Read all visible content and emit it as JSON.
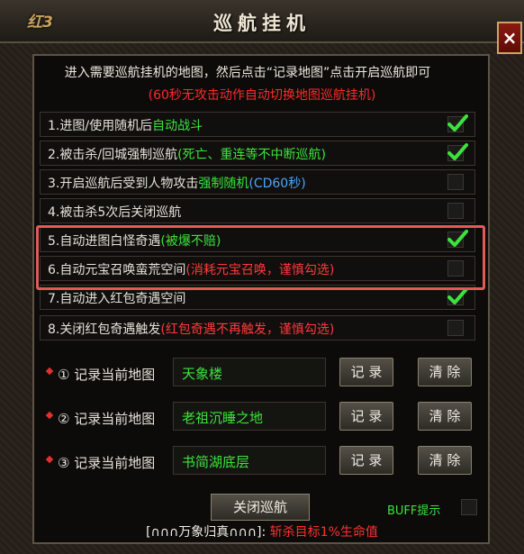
{
  "window": {
    "title": "巡航挂机",
    "logo_text": "红3",
    "close_label": "×"
  },
  "intro": {
    "line1": "进入需要巡航挂机的地图，然后点击“记录地图”点击开启巡航即可",
    "line2": "(60秒无攻击动作自动切换地图巡航挂机)"
  },
  "options": [
    {
      "main": "1.进图/使用随机后",
      "sub": "自动战斗",
      "sub_color": "green",
      "extra": "",
      "checked": true
    },
    {
      "main": "2.被击杀/回城强制巡航",
      "sub": "(死亡、重连等不中断巡航)",
      "sub_color": "green",
      "extra": "",
      "checked": true
    },
    {
      "main": "3.开启巡航后受到人物攻击",
      "sub": "强制随机",
      "sub_color": "green",
      "extra": "(CD60秒)",
      "checked": false
    },
    {
      "main": "4.被击杀5次后关闭巡航",
      "sub": "",
      "sub_color": "",
      "extra": "",
      "checked": false
    },
    {
      "main": "5.自动进图白怪奇遇",
      "sub": "(被爆不赔)",
      "sub_color": "green",
      "extra": "",
      "checked": true
    },
    {
      "main": "6.自动元宝召唤蛮荒空间",
      "sub": "(消耗元宝召唤，谨慎勾选)",
      "sub_color": "red",
      "extra": "",
      "checked": false
    },
    {
      "main": "7.自动进入红包奇遇空间",
      "sub": "",
      "sub_color": "",
      "extra": "",
      "checked": true
    },
    {
      "main": "8.关闭红包奇遇触发",
      "sub": "(红包奇遇不再触发，谨慎勾选)",
      "sub_color": "red",
      "extra": "",
      "checked": false
    }
  ],
  "records": [
    {
      "label": "① 记录当前地图",
      "map": "天象楼",
      "record_btn": "记 录",
      "clear_btn": "清 除"
    },
    {
      "label": "② 记录当前地图",
      "map": "老祖沉睡之地",
      "record_btn": "记 录",
      "clear_btn": "清 除"
    },
    {
      "label": "③ 记录当前地图",
      "map": "书简湖底层",
      "record_btn": "记 录",
      "clear_btn": "清 除"
    }
  ],
  "bottom": {
    "close_cruise_label": "关闭巡航",
    "buff_label": "BUFF提示",
    "buff_checked": false,
    "footer_name": "[∩∩∩万象归真∩∩∩]:",
    "footer_effect": "斩杀目标1%生命值"
  },
  "colors": {
    "green": "#3de33d",
    "red": "#ff3a3a",
    "blue": "#4aa6ff",
    "highlight": "#e05a5a"
  },
  "icons": {
    "check": "check-icon",
    "close": "close-icon",
    "diamond": "diamond-icon"
  }
}
